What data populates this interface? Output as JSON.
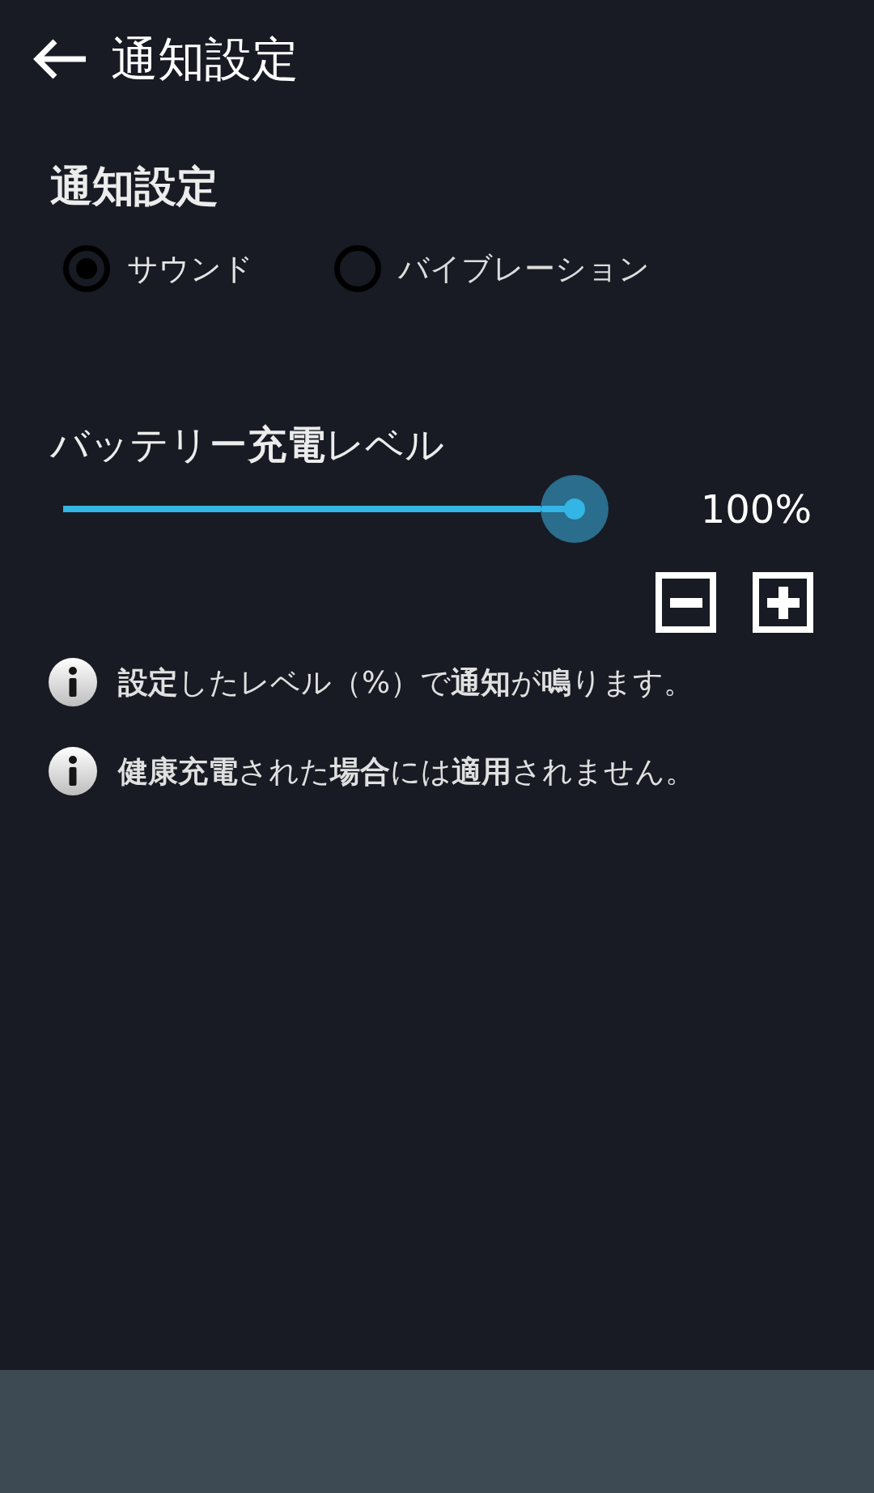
{
  "app_bar": {
    "title": "通知設定"
  },
  "notification": {
    "heading": "通知設定",
    "options": [
      {
        "label": "サウンド",
        "selected": true
      },
      {
        "label": "バイブレーション",
        "selected": false
      }
    ]
  },
  "battery_level": {
    "heading": "バッテリー**充電**レベル",
    "level": 1,
    "reading": "100%"
  },
  "notes": [
    {
      "text": "**設定**したレベル（%）で**通知**が**鳴**ります。"
    },
    {
      "text": "**健康充電**された**場合**には**適用**されません。"
    }
  ]
}
